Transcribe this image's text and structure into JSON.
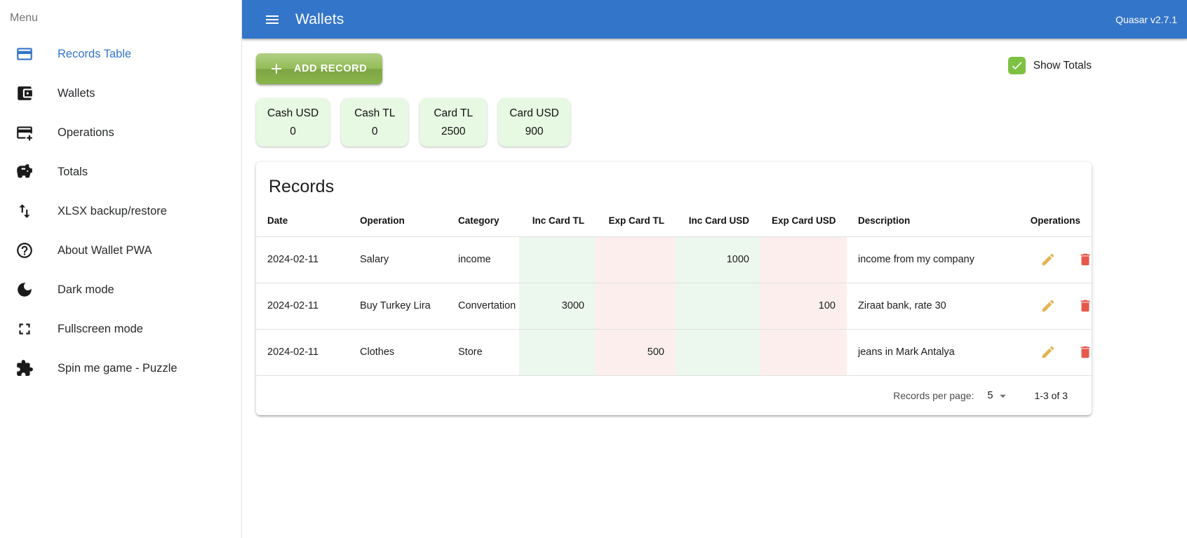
{
  "colors": {
    "primary_blue": "#3375c8",
    "button_green": "#8cb84c",
    "checkbox_green": "#7ec142",
    "wallet_card_bg": "#e7f8e3",
    "stripe_green": "#ecf7ee",
    "stripe_pink": "#fdeeee",
    "edit_icon": "#e2b452",
    "delete_icon": "#e5584a"
  },
  "header": {
    "title": "Wallets",
    "version": "Quasar v2.7.1",
    "menu_icon": "hamburger-icon"
  },
  "drawer": {
    "menu_label": "Menu",
    "items": [
      {
        "label": "Records Table",
        "icon": "credit-card-icon",
        "active": true
      },
      {
        "label": "Wallets",
        "icon": "wallet-icon",
        "active": false
      },
      {
        "label": "Operations",
        "icon": "add-card-icon",
        "active": false
      },
      {
        "label": "Totals",
        "icon": "piggy-bank-icon",
        "active": false
      },
      {
        "label": "XLSX backup/restore",
        "icon": "import-export-icon",
        "active": false
      },
      {
        "label": "About Wallet PWA",
        "icon": "help-icon",
        "active": false
      },
      {
        "label": "Dark mode",
        "icon": "moon-icon",
        "active": false
      },
      {
        "label": "Fullscreen mode",
        "icon": "fullscreen-icon",
        "active": false
      },
      {
        "label": "Spin me game - Puzzle",
        "icon": "puzzle-icon",
        "active": false
      }
    ]
  },
  "toolbar": {
    "add_record_label": "ADD RECORD",
    "show_totals_label": "Show Totals",
    "show_totals_checked": true
  },
  "wallet_cards": [
    {
      "name": "Cash USD",
      "value": "0"
    },
    {
      "name": "Cash TL",
      "value": "0"
    },
    {
      "name": "Card TL",
      "value": "2500"
    },
    {
      "name": "Card USD",
      "value": "900"
    }
  ],
  "records": {
    "title": "Records",
    "columns": [
      "Date",
      "Operation",
      "Category",
      "Inc Card TL",
      "Exp Card TL",
      "Inc Card USD",
      "Exp Card USD",
      "Description",
      "Operations"
    ],
    "rows": [
      {
        "date": "2024-02-11",
        "operation": "Salary",
        "category": "income",
        "inc_card_tl": "",
        "exp_card_tl": "",
        "inc_card_usd": "1000",
        "exp_card_usd": "",
        "description": "income from my company"
      },
      {
        "date": "2024-02-11",
        "operation": "Buy Turkey Lira",
        "category": "Convertation",
        "inc_card_tl": "3000",
        "exp_card_tl": "",
        "inc_card_usd": "",
        "exp_card_usd": "100",
        "description": "Ziraat bank, rate 30"
      },
      {
        "date": "2024-02-11",
        "operation": "Clothes",
        "category": "Store",
        "inc_card_tl": "",
        "exp_card_tl": "500",
        "inc_card_usd": "",
        "exp_card_usd": "",
        "description": "jeans in Mark Antalya"
      }
    ],
    "pagination": {
      "per_page_label": "Records per page:",
      "per_page_value": "5",
      "range_label": "1-3 of 3"
    }
  }
}
